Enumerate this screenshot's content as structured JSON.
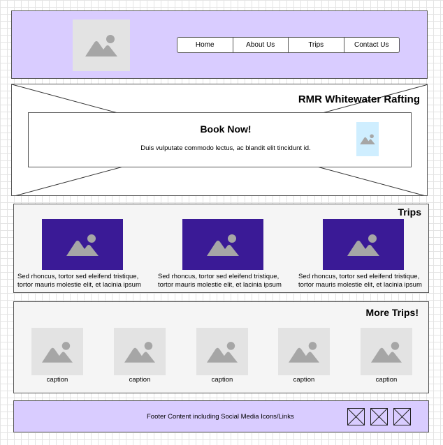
{
  "nav": {
    "items": [
      {
        "label": "Home"
      },
      {
        "label": "About Us"
      },
      {
        "label": "Trips"
      },
      {
        "label": "Contact Us"
      }
    ]
  },
  "hero": {
    "title": "RMR Whitewater Rafting",
    "book_title": "Book Now!",
    "book_text": "Duis vulputate commodo lectus, ac blandit elit tincidunt id."
  },
  "trips": {
    "title": "Trips",
    "items": [
      {
        "line1": "Sed rhoncus, tortor sed eleifend tristique,",
        "line2": "tortor mauris molestie elit, et lacinia ipsum"
      },
      {
        "line1": "Sed rhoncus, tortor sed eleifend tristique,",
        "line2": "tortor mauris molestie elit, et lacinia ipsum"
      },
      {
        "line1": "Sed rhoncus, tortor sed eleifend tristique,",
        "line2": "tortor mauris molestie elit, et lacinia ipsum"
      }
    ]
  },
  "more_trips": {
    "title": "More Trips!",
    "items": [
      {
        "caption": "caption"
      },
      {
        "caption": "caption"
      },
      {
        "caption": "caption"
      },
      {
        "caption": "caption"
      },
      {
        "caption": "caption"
      }
    ]
  },
  "footer": {
    "text": "Footer Content including Social Media Icons/Links",
    "social_icons": [
      "placeholder-icon",
      "placeholder-icon",
      "placeholder-icon"
    ]
  },
  "colors": {
    "header_bg": "#d9ccff",
    "trip_image_bg": "#3a1a96",
    "placeholder_bg": "#e3e3e3",
    "book_image_bg": "#cfeeff",
    "section_bg": "#f5f5f5"
  }
}
